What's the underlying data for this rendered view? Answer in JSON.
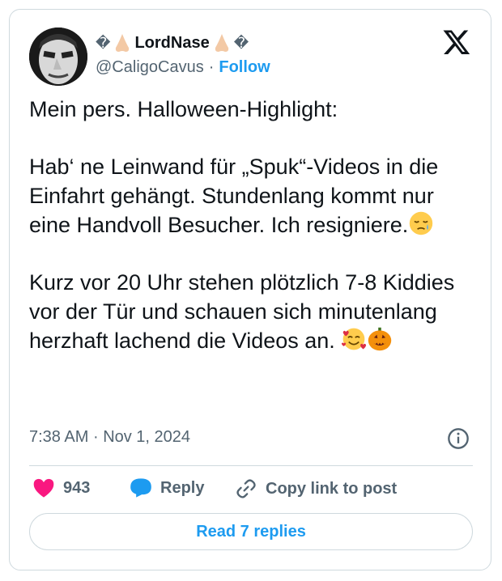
{
  "user": {
    "display_name": "LordNase",
    "handle": "@CaligoCavus",
    "separator": "·",
    "follow_label": "Follow",
    "avatar_icon": "avatar-face-icon",
    "name_emoji": "nose-emoji",
    "side_glyph": "�"
  },
  "tweet": {
    "line1": "Mein pers. Halloween-Highlight:",
    "para2": "Hab‘ ne Leinwand für „Spuk“-Videos in die Einfahrt gehängt. Stundenlang kommt nur eine Handvoll Besucher. Ich resigniere.",
    "para3": "Kurz vor 20 Uhr stehen plötzlich 7-8 Kiddies vor der Tür und schauen sich minutenlang herzhaft lachend die Videos an."
  },
  "meta": {
    "time": "7:38 AM",
    "separator": "·",
    "date": "Nov 1, 2024"
  },
  "actions": {
    "like_count": "943",
    "reply_label": "Reply",
    "copy_label": "Copy link to post"
  },
  "read_replies_label": "Read 7 replies",
  "colors": {
    "accent": "#1d9bf0",
    "heart": "#f91880",
    "text": "#0f1419",
    "muted": "#536471"
  }
}
